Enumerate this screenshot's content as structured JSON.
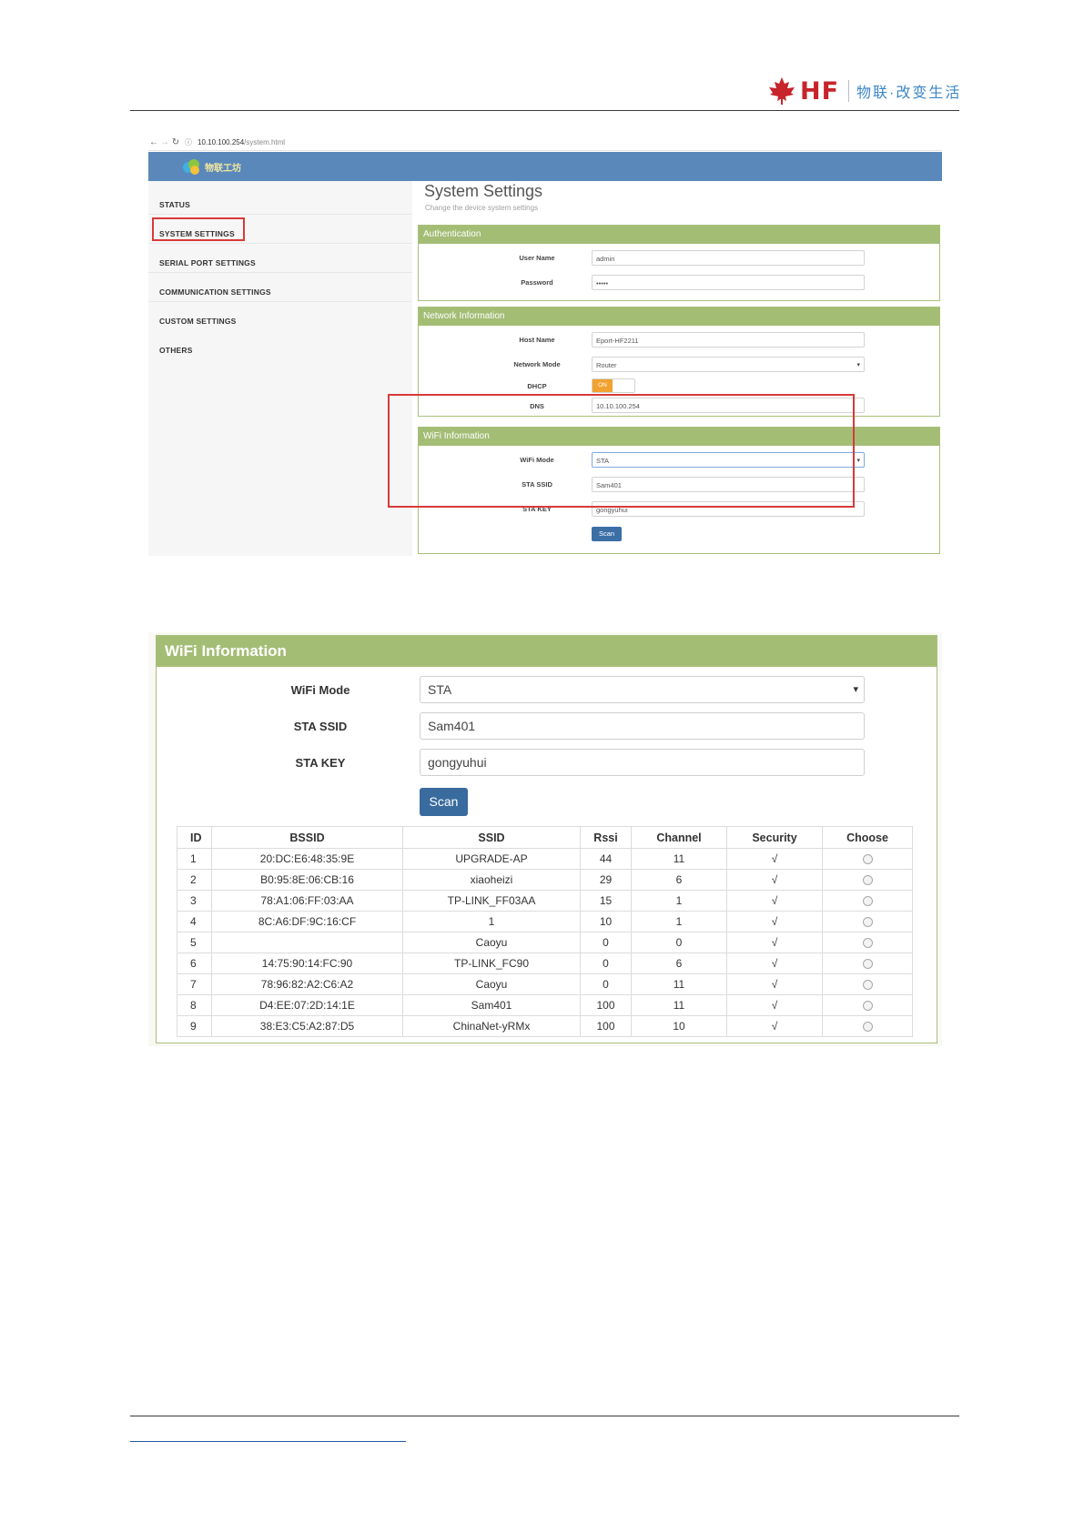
{
  "header": {
    "logo_text": "HF",
    "slogan": "物联·改变生活",
    "colors": {
      "logo_red": "#c8242b",
      "slogan_blue": "#3d86c6"
    }
  },
  "browser": {
    "url_host": "10.10.100.254",
    "url_path": "/system.html",
    "brand_text": "物联工坊"
  },
  "sidebar": {
    "items": [
      {
        "label": "STATUS"
      },
      {
        "label": "SYSTEM SETTINGS",
        "highlighted": true
      },
      {
        "label": "SERIAL PORT SETTINGS"
      },
      {
        "label": "COMMUNICATION SETTINGS"
      },
      {
        "label": "CUSTOM SETTINGS"
      },
      {
        "label": "OTHERS"
      }
    ]
  },
  "main": {
    "title": "System Settings",
    "subtitle": "Change the device system settings",
    "authentication": {
      "heading": "Authentication",
      "user_name_label": "User Name",
      "user_name_value": "admin",
      "password_label": "Password",
      "password_value": "•••••"
    },
    "network": {
      "heading": "Network Information",
      "host_name_label": "Host Name",
      "host_name_value": "Eport-HF2211",
      "network_mode_label": "Network Mode",
      "network_mode_value": "Router",
      "dhcp_label": "DHCP",
      "dhcp_state": "ON",
      "dns_label": "DNS",
      "dns_value": "10.10.100.254"
    },
    "wifi": {
      "heading": "WiFi Information",
      "wifi_mode_label": "WiFi Mode",
      "wifi_mode_value": "STA",
      "sta_ssid_label": "STA SSID",
      "sta_ssid_value": "Sam401",
      "sta_key_label": "STA KEY",
      "sta_key_value": "gongyuhui",
      "scan_label": "Scan"
    }
  },
  "wifi_detail": {
    "heading": "WiFi Information",
    "wifi_mode_label": "WiFi Mode",
    "wifi_mode_value": "STA",
    "sta_ssid_label": "STA SSID",
    "sta_ssid_value": "Sam401",
    "sta_key_label": "STA KEY",
    "sta_key_value": "gongyuhui",
    "scan_label": "Scan",
    "table": {
      "columns": [
        "ID",
        "BSSID",
        "SSID",
        "Rssi",
        "Channel",
        "Security",
        "Choose"
      ],
      "rows": [
        {
          "id": "1",
          "bssid": "20:DC:E6:48:35:9E",
          "ssid": "UPGRADE-AP",
          "rssi": "44",
          "channel": "11",
          "security": "√"
        },
        {
          "id": "2",
          "bssid": "B0:95:8E:06:CB:16",
          "ssid": "xiaoheizi",
          "rssi": "29",
          "channel": "6",
          "security": "√"
        },
        {
          "id": "3",
          "bssid": "78:A1:06:FF:03:AA",
          "ssid": "TP-LINK_FF03AA",
          "rssi": "15",
          "channel": "1",
          "security": "√"
        },
        {
          "id": "4",
          "bssid": "8C:A6:DF:9C:16:CF",
          "ssid": "1",
          "rssi": "10",
          "channel": "1",
          "security": "√"
        },
        {
          "id": "5",
          "bssid": "",
          "ssid": "Caoyu",
          "rssi": "0",
          "channel": "0",
          "security": "√"
        },
        {
          "id": "6",
          "bssid": "14:75:90:14:FC:90",
          "ssid": "TP-LINK_FC90",
          "rssi": "0",
          "channel": "6",
          "security": "√"
        },
        {
          "id": "7",
          "bssid": "78:96:82:A2:C6:A2",
          "ssid": "Caoyu",
          "rssi": "0",
          "channel": "11",
          "security": "√"
        },
        {
          "id": "8",
          "bssid": "D4:EE:07:2D:14:1E",
          "ssid": "Sam401",
          "rssi": "100",
          "channel": "11",
          "security": "√"
        },
        {
          "id": "9",
          "bssid": "38:E3:C5:A2:87:D5",
          "ssid": "ChinaNet-yRMx",
          "rssi": "100",
          "channel": "10",
          "security": "√"
        }
      ]
    }
  }
}
